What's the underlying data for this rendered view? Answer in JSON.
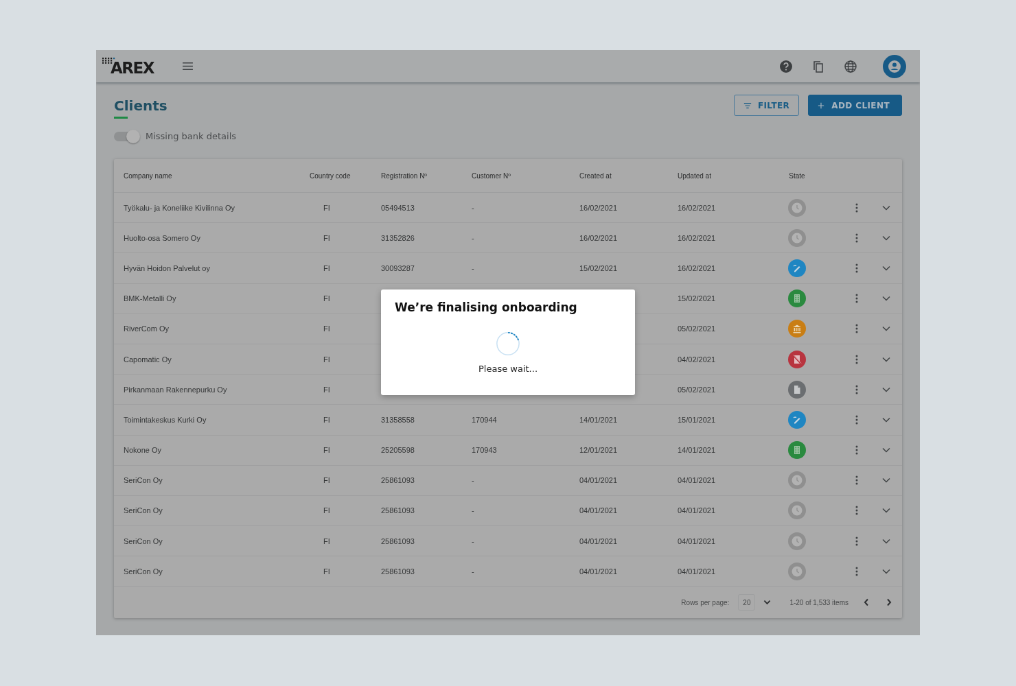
{
  "app": {
    "logo": "AREX"
  },
  "page": {
    "title": "Clients",
    "filter_button": "FILTER",
    "add_button": "ADD CLIENT"
  },
  "bank_toggle": {
    "label": "Missing bank details",
    "on": true
  },
  "table": {
    "columns": [
      "Company name",
      "Country code",
      "Registration Nº",
      "Customer Nº",
      "Created at",
      "Updated at",
      "State"
    ],
    "rows": [
      {
        "company": "Työkalu- ja Koneliike Kivilinna Oy",
        "country": "FI",
        "registration": "05494513",
        "customer": "-",
        "created": "16/02/2021",
        "updated": "16/02/2021",
        "state": {
          "kind": "clock",
          "color": "#8f8f8f"
        }
      },
      {
        "company": "Huolto-osa Somero Oy",
        "country": "FI",
        "registration": "31352826",
        "customer": "-",
        "created": "16/02/2021",
        "updated": "16/02/2021",
        "state": {
          "kind": "clock",
          "color": "#8f8f8f"
        }
      },
      {
        "company": "Hyvän Hoidon Palvelut oy",
        "country": "FI",
        "registration": "30093287",
        "customer": "-",
        "created": "15/02/2021",
        "updated": "16/02/2021",
        "state": {
          "kind": "pen",
          "color": "#1f86c2"
        }
      },
      {
        "company": "BMK-Metalli Oy",
        "country": "FI",
        "updated": "15/02/2021",
        "state": {
          "kind": "building",
          "color": "#2a8a3f"
        }
      },
      {
        "company": "RiverCom Oy",
        "country": "FI",
        "updated": "05/02/2021",
        "state": {
          "kind": "bank",
          "color": "#c97e14"
        }
      },
      {
        "company": "Capomatic Oy",
        "country": "FI",
        "updated": "04/02/2021",
        "state": {
          "kind": "crossed",
          "color": "#b8343f"
        }
      },
      {
        "company": "Pirkanmaan Rakennepurku Oy",
        "country": "FI",
        "updated": "05/02/2021",
        "state": {
          "kind": "document",
          "color": "#6b6e71"
        }
      },
      {
        "company": "Toimintakeskus Kurki Oy",
        "country": "FI",
        "registration": "31358558",
        "customer": "170944",
        "created": "14/01/2021",
        "updated": "15/01/2021",
        "state": {
          "kind": "pen",
          "color": "#1f86c2"
        }
      },
      {
        "company": "Nokone Oy",
        "country": "FI",
        "registration": "25205598",
        "customer": "170943",
        "created": "12/01/2021",
        "updated": "14/01/2021",
        "state": {
          "kind": "building",
          "color": "#2a8a3f"
        }
      },
      {
        "company": "SeriCon Oy",
        "country": "FI",
        "registration": "25861093",
        "customer": "-",
        "created": "04/01/2021",
        "updated": "04/01/2021",
        "state": {
          "kind": "clock",
          "color": "#8f8f8f"
        }
      },
      {
        "company": "SeriCon Oy",
        "country": "FI",
        "registration": "25861093",
        "customer": "-",
        "created": "04/01/2021",
        "updated": "04/01/2021",
        "state": {
          "kind": "clock",
          "color": "#8f8f8f"
        }
      },
      {
        "company": "SeriCon Oy",
        "country": "FI",
        "registration": "25861093",
        "customer": "-",
        "created": "04/01/2021",
        "updated": "04/01/2021",
        "state": {
          "kind": "clock",
          "color": "#8f8f8f"
        }
      },
      {
        "company": "SeriCon Oy",
        "country": "FI",
        "registration": "25861093",
        "customer": "-",
        "created": "04/01/2021",
        "updated": "04/01/2021",
        "state": {
          "kind": "clock",
          "color": "#8f8f8f"
        }
      }
    ]
  },
  "pagination": {
    "rows_label": "Rows per page:",
    "rows_value": "20",
    "range": "1-20 of 1,533 items"
  },
  "dialog": {
    "title": "We’re finalising onboarding",
    "message": "Please wait..."
  }
}
